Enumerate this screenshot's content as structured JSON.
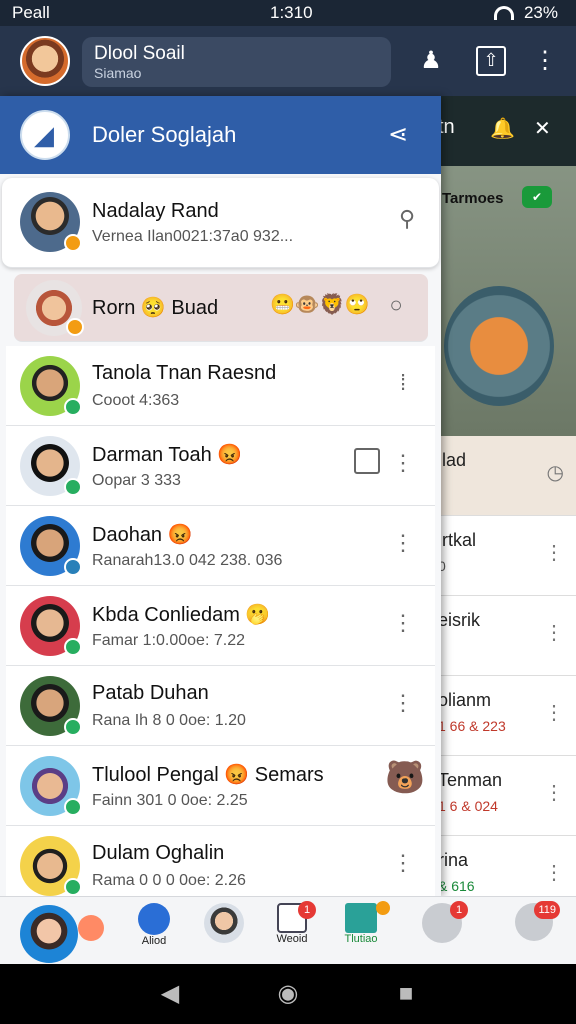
{
  "status_bar": {
    "carrier": "Peall",
    "time": "1:310",
    "battery": "23%"
  },
  "app_header": {
    "title": "Dlool Soail",
    "subtitle": "Siamao"
  },
  "drawer": {
    "title": "Doler Soglajah"
  },
  "background_panel": {
    "header_text": "tn",
    "label": "Tarmoes",
    "cards": [
      {
        "name": "ilad",
        "sub": ""
      },
      {
        "name": "irtkal",
        "sub": "0"
      },
      {
        "name": "eisrik",
        "sub": ""
      },
      {
        "name": "olianm",
        "sub": "1 66 & 223"
      },
      {
        "name": "Tenman",
        "sub": "1 6 & 024"
      },
      {
        "name": "rina",
        "sub": "& 616"
      }
    ]
  },
  "contacts": [
    {
      "name": "Nadalay Rand",
      "sub": "Vernea Ilan0021:37a0 932..."
    },
    {
      "name": "Rorn 🥺 Buad",
      "sub": ""
    },
    {
      "name": "Tanola Tnan Raesnd",
      "sub": "Cooot 4:363"
    },
    {
      "name": "Darman Toah 😡",
      "sub": "Oopar 3 333"
    },
    {
      "name": "Daohan 😡",
      "sub": "Ranarah13.0 042 238. 036"
    },
    {
      "name": "Kbda Conliedam 🫢",
      "sub": "Famar 1:0.00oe: 7.22"
    },
    {
      "name": "Patab Duhan",
      "sub": "Rana Ih 8 0 0oe: 1.20"
    },
    {
      "name": "Tlulool Pengal 😡 Semars",
      "sub": "Fainn 301 0 0oe: 2.25"
    },
    {
      "name": "Dulam Oghalin",
      "sub": "Rama 0 0 0 0oe: 2.26"
    }
  ],
  "bottom_nav": [
    {
      "label": ""
    },
    {
      "label": "Aliod"
    },
    {
      "label": ""
    },
    {
      "label": "Weoid",
      "badge": "1"
    },
    {
      "label": "Tlutiao",
      "badge": ""
    },
    {
      "label": "",
      "badge": "1"
    },
    {
      "label": "",
      "badge": "119"
    }
  ],
  "colors": {
    "header": "#27354c",
    "drawer_header": "#2f5ea8",
    "highlight_row": "#eadcdc",
    "badge_red": "#e53935"
  }
}
